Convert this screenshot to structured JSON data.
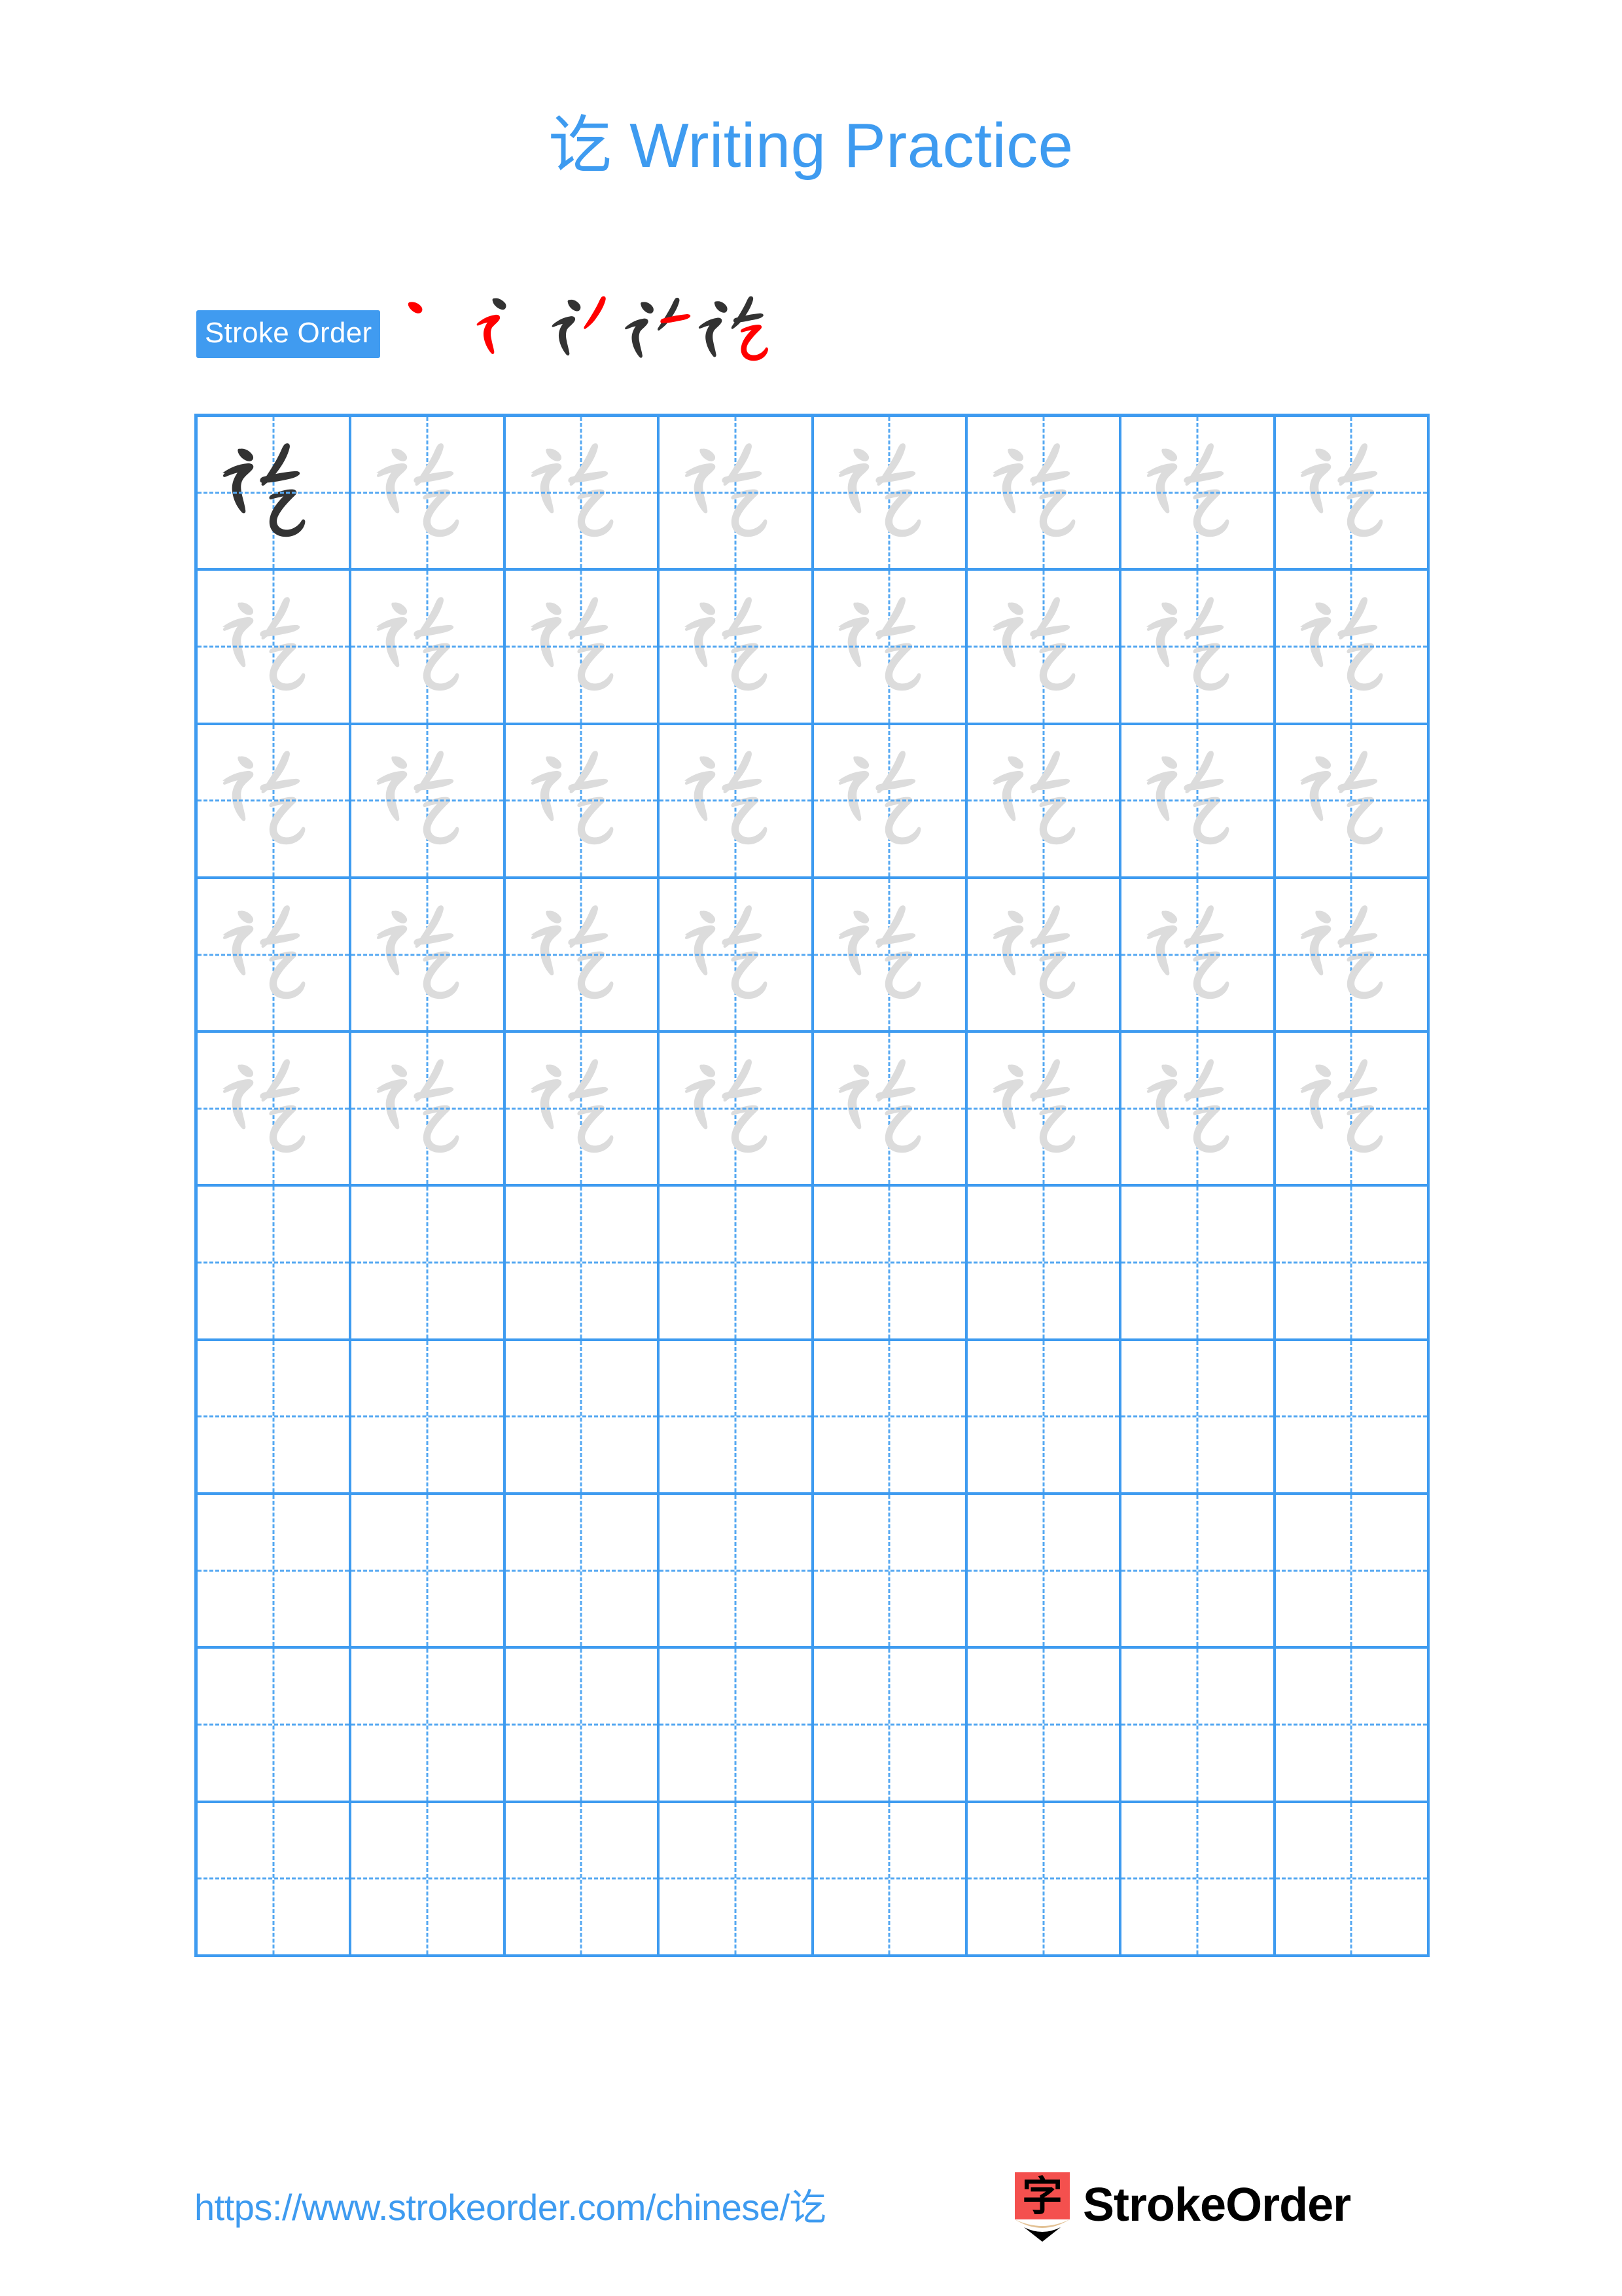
{
  "document": {
    "title": "讫 Writing Practice",
    "character": "讫",
    "character_name": "讫"
  },
  "stroke_order": {
    "label": "Stroke Order",
    "badge_color": "#409bf0",
    "badge_text_color": "#ffffff",
    "total_strokes": 5,
    "new_stroke_color": "#ff0000",
    "existing_stroke_color": "#333333",
    "steps": [
      {
        "index": 1,
        "stroke_name": "dian",
        "description": "dot"
      },
      {
        "index": 2,
        "stroke_name": "hengzhetiao",
        "description": "horizontal-fold-rise"
      },
      {
        "index": 3,
        "stroke_name": "pie",
        "description": "left-falling"
      },
      {
        "index": 4,
        "stroke_name": "heng",
        "description": "horizontal"
      },
      {
        "index": 5,
        "stroke_name": "hengzhewangou",
        "description": "horizontal-bend-hook"
      }
    ]
  },
  "practice_grid": {
    "columns": 8,
    "rows": 10,
    "grid_line_color": "#3e9bf0",
    "guide_line_color": "#55a8f2",
    "dark_char_color": "#333333",
    "light_char_color": "#dcdcdc",
    "cells": [
      [
        "dark",
        "light",
        "light",
        "light",
        "light",
        "light",
        "light",
        "light"
      ],
      [
        "light",
        "light",
        "light",
        "light",
        "light",
        "light",
        "light",
        "light"
      ],
      [
        "light",
        "light",
        "light",
        "light",
        "light",
        "light",
        "light",
        "light"
      ],
      [
        "light",
        "light",
        "light",
        "light",
        "light",
        "light",
        "light",
        "light"
      ],
      [
        "light",
        "light",
        "light",
        "light",
        "light",
        "light",
        "light",
        "light"
      ],
      [
        "empty",
        "empty",
        "empty",
        "empty",
        "empty",
        "empty",
        "empty",
        "empty"
      ],
      [
        "empty",
        "empty",
        "empty",
        "empty",
        "empty",
        "empty",
        "empty",
        "empty"
      ],
      [
        "empty",
        "empty",
        "empty",
        "empty",
        "empty",
        "empty",
        "empty",
        "empty"
      ],
      [
        "empty",
        "empty",
        "empty",
        "empty",
        "empty",
        "empty",
        "empty",
        "empty"
      ],
      [
        "empty",
        "empty",
        "empty",
        "empty",
        "empty",
        "empty",
        "empty",
        "empty"
      ]
    ]
  },
  "footer": {
    "url": "https://www.strokeorder.com/chinese/讫",
    "brand_name": "StrokeOrder",
    "logo_glyph": "字",
    "logo_body_color": "#f4504e",
    "logo_wood_color": "#e3c296",
    "logo_tip_color": "#000000"
  }
}
